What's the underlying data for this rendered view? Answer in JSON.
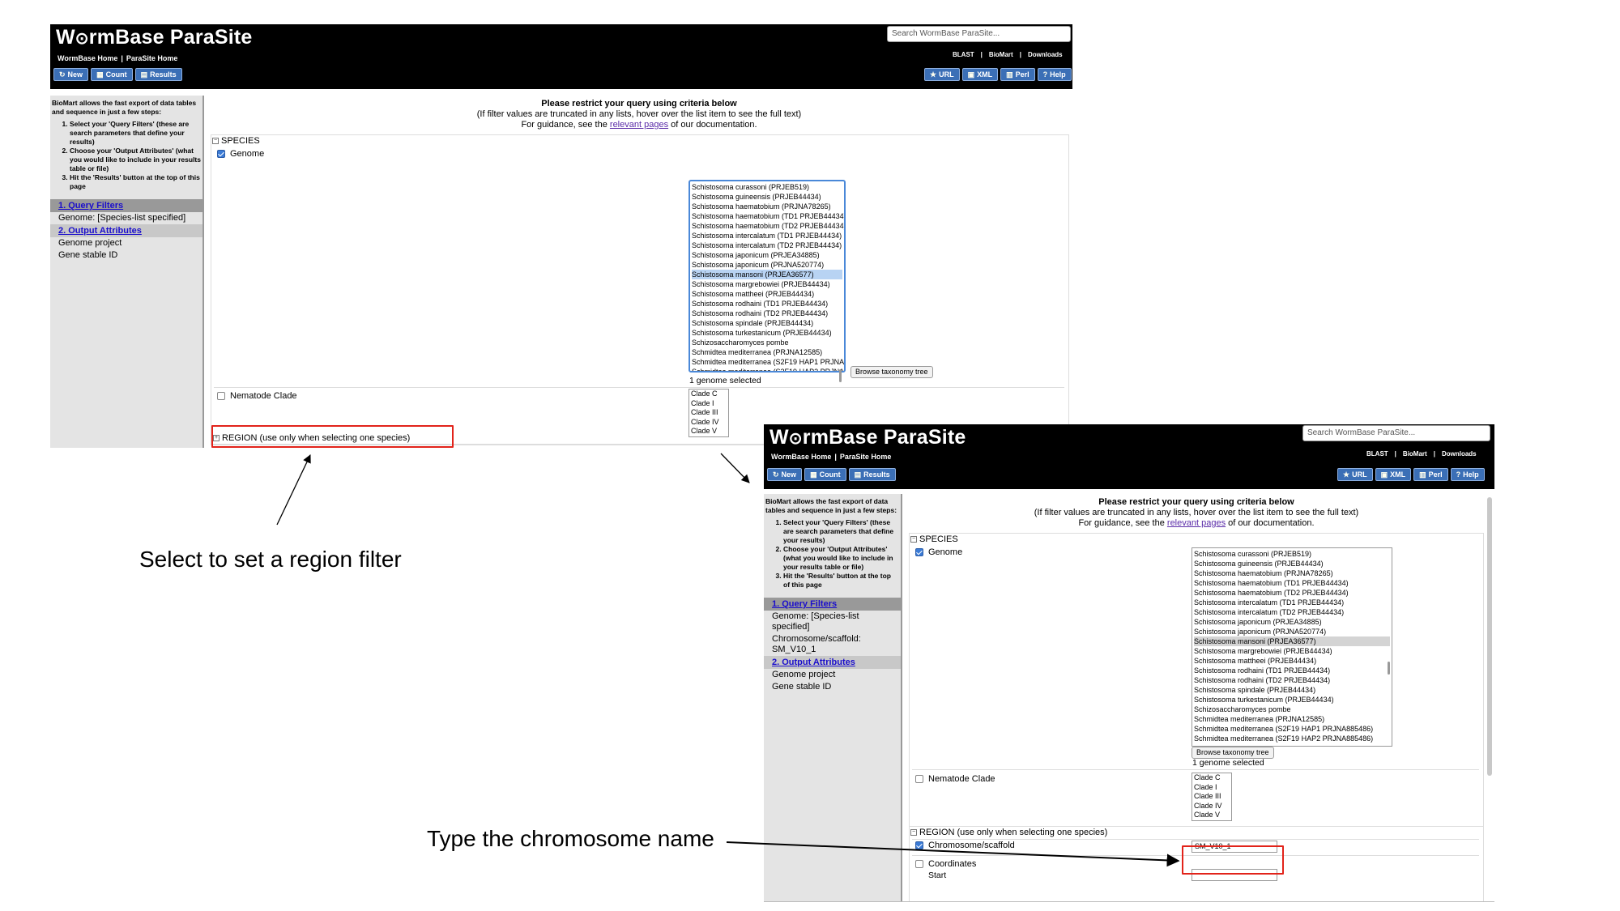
{
  "header": {
    "logo_a": "W",
    "logo_b": "rmBase ParaSite",
    "links": [
      "WormBase Home",
      "|",
      "ParaSite Home"
    ],
    "search_placeholder": "Search WormBase ParaSite...",
    "top_links": [
      "BLAST",
      "|",
      "BioMart",
      "|",
      "Downloads"
    ],
    "buttons": [
      {
        "label": "New",
        "icon": "refresh-icon"
      },
      {
        "label": "Count",
        "icon": "count-icon"
      },
      {
        "label": "Results",
        "icon": "table-icon"
      }
    ],
    "right_buttons": [
      {
        "label": "URL",
        "icon": "star-icon"
      },
      {
        "label": "XML",
        "icon": "xml-icon"
      },
      {
        "label": "Perl",
        "icon": "perl-icon"
      },
      {
        "label": "Help",
        "icon": "help-icon"
      }
    ]
  },
  "sidebar": {
    "intro": "BioMart allows the fast export of data tables and sequence in just a few steps:",
    "steps": [
      "Select your 'Query Filters' (these are search parameters that define your results)",
      "Choose your 'Output Attributes' (what you would like to include in your results table or file)",
      "Hit the 'Results' button at the top of this page"
    ],
    "query_filters": "1. Query Filters",
    "filter_genome": "Genome: [Species-list specified]",
    "filter_genome_2a": "Genome: [Species-list",
    "filter_genome_2b": "specified]",
    "filter_chrom_a": "Chromosome/scaffold:",
    "filter_chrom_b": "SM_V10_1",
    "output_attributes": "2. Output Attributes",
    "attr_1": "Genome project",
    "attr_2": "Gene stable ID"
  },
  "main": {
    "title": "Please restrict your query using criteria below",
    "subtitle": "(If filter values are truncated in any lists, hover over the list item to see the full text)",
    "guidance_pre": "For guidance, see the ",
    "guidance_link": "relevant pages",
    "guidance_post": " of our documentation.",
    "species_section": "SPECIES",
    "genome_label": "Genome",
    "species_options": [
      "Schistosoma curassoni (PRJEB519)",
      "Schistosoma guineensis (PRJEB44434)",
      "Schistosoma haematobium (PRJNA78265)",
      "Schistosoma haematobium (TD1 PRJEB44434)",
      "Schistosoma haematobium (TD2 PRJEB44434)",
      "Schistosoma intercalatum (TD1 PRJEB44434)",
      "Schistosoma intercalatum (TD2 PRJEB44434)",
      "Schistosoma japonicum (PRJEA34885)",
      "Schistosoma japonicum (PRJNA520774)",
      "Schistosoma mansoni (PRJEA36577)",
      "Schistosoma margrebowiei (PRJEB44434)",
      "Schistosoma mattheei (PRJEB44434)",
      "Schistosoma rodhaini (TD1 PRJEB44434)",
      "Schistosoma rodhaini (TD2 PRJEB44434)",
      "Schistosoma spindale (PRJEB44434)",
      "Schistosoma turkestanicum (PRJEB44434)",
      "Schizosaccharomyces pombe",
      "Schmidtea mediterranea (PRJNA12585)",
      "Schmidtea mediterranea (S2F19 HAP1 PRJNA885486)",
      "Schmidtea mediterranea (S2F19 HAP2 PRJNA885486)"
    ],
    "browse_tree": "Browse taxonomy tree",
    "genome_selected": "1 genome selected",
    "clade_label": "Nematode Clade",
    "clade_options": [
      "Clade C",
      "Clade I",
      "Clade III",
      "Clade IV",
      "Clade V"
    ],
    "region_section": "REGION (use only when selecting one species)",
    "chrom_label": "Chromosome/scaffold",
    "chrom_value": "SM_V10_1",
    "coords_label": "Coordinates",
    "start_label": "Start"
  },
  "annotations": {
    "region_hint": "Select to set a region filter",
    "chrom_hint": "Type the chromosome name"
  },
  "colors": {
    "highlight_box": "#e2231a",
    "header_bg": "#000000",
    "button_blue": "#3b6fb6"
  }
}
